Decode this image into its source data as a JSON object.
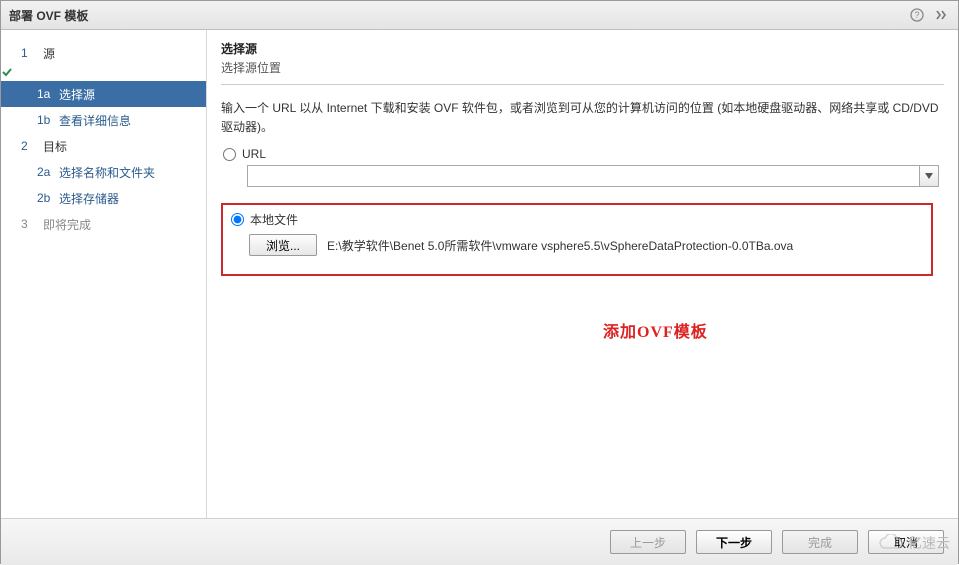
{
  "titlebar": {
    "title": "部署 OVF 模板"
  },
  "sidebar": {
    "items": [
      {
        "num": "1",
        "label": "源"
      },
      {
        "num": "1a",
        "label": "选择源"
      },
      {
        "num": "1b",
        "label": "查看详细信息"
      },
      {
        "num": "2",
        "label": "目标"
      },
      {
        "num": "2a",
        "label": "选择名称和文件夹"
      },
      {
        "num": "2b",
        "label": "选择存储器"
      },
      {
        "num": "3",
        "label": "即将完成"
      }
    ]
  },
  "content": {
    "heading": "选择源",
    "subheading": "选择源位置",
    "description": "输入一个 URL 以从 Internet 下载和安装 OVF 软件包，或者浏览到可从您的计算机访问的位置 (如本地硬盘驱动器、网络共享或 CD/DVD 驱动器)。",
    "url_option_label": "URL",
    "url_value": "",
    "local_option_label": "本地文件",
    "browse_label": "浏览...",
    "file_path": "E:\\教学软件\\Benet 5.0所需软件\\vmware vsphere5.5\\vSphereDataProtection-0.0TBa.ova",
    "annotation": "添加OVF模板"
  },
  "footer": {
    "back": "上一步",
    "next": "下一步",
    "finish": "完成",
    "cancel": "取消"
  },
  "watermark": "亿速云"
}
